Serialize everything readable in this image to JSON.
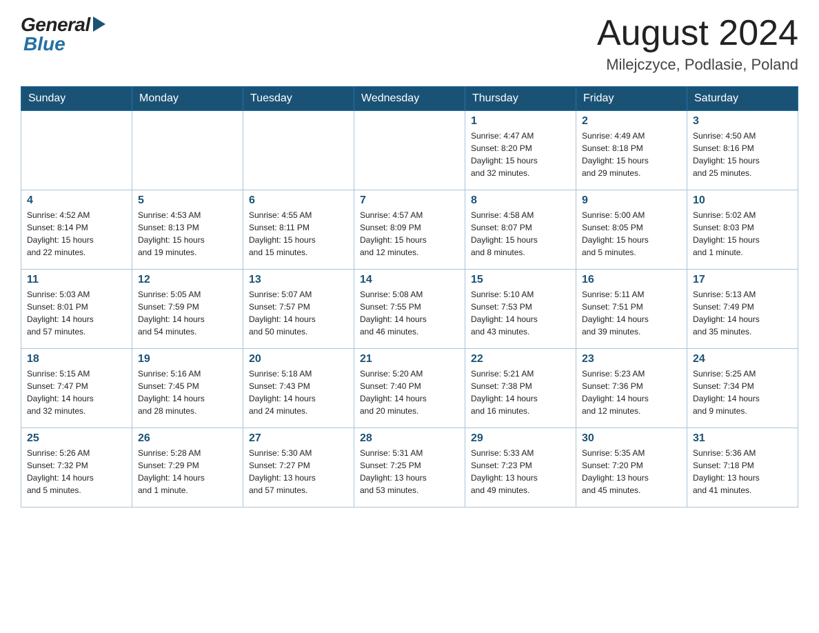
{
  "header": {
    "title": "August 2024",
    "subtitle": "Milejczyce, Podlasie, Poland",
    "logo_general": "General",
    "logo_blue": "Blue"
  },
  "days_of_week": [
    "Sunday",
    "Monday",
    "Tuesday",
    "Wednesday",
    "Thursday",
    "Friday",
    "Saturday"
  ],
  "weeks": [
    {
      "days": [
        {
          "num": "",
          "info": ""
        },
        {
          "num": "",
          "info": ""
        },
        {
          "num": "",
          "info": ""
        },
        {
          "num": "",
          "info": ""
        },
        {
          "num": "1",
          "info": "Sunrise: 4:47 AM\nSunset: 8:20 PM\nDaylight: 15 hours\nand 32 minutes."
        },
        {
          "num": "2",
          "info": "Sunrise: 4:49 AM\nSunset: 8:18 PM\nDaylight: 15 hours\nand 29 minutes."
        },
        {
          "num": "3",
          "info": "Sunrise: 4:50 AM\nSunset: 8:16 PM\nDaylight: 15 hours\nand 25 minutes."
        }
      ]
    },
    {
      "days": [
        {
          "num": "4",
          "info": "Sunrise: 4:52 AM\nSunset: 8:14 PM\nDaylight: 15 hours\nand 22 minutes."
        },
        {
          "num": "5",
          "info": "Sunrise: 4:53 AM\nSunset: 8:13 PM\nDaylight: 15 hours\nand 19 minutes."
        },
        {
          "num": "6",
          "info": "Sunrise: 4:55 AM\nSunset: 8:11 PM\nDaylight: 15 hours\nand 15 minutes."
        },
        {
          "num": "7",
          "info": "Sunrise: 4:57 AM\nSunset: 8:09 PM\nDaylight: 15 hours\nand 12 minutes."
        },
        {
          "num": "8",
          "info": "Sunrise: 4:58 AM\nSunset: 8:07 PM\nDaylight: 15 hours\nand 8 minutes."
        },
        {
          "num": "9",
          "info": "Sunrise: 5:00 AM\nSunset: 8:05 PM\nDaylight: 15 hours\nand 5 minutes."
        },
        {
          "num": "10",
          "info": "Sunrise: 5:02 AM\nSunset: 8:03 PM\nDaylight: 15 hours\nand 1 minute."
        }
      ]
    },
    {
      "days": [
        {
          "num": "11",
          "info": "Sunrise: 5:03 AM\nSunset: 8:01 PM\nDaylight: 14 hours\nand 57 minutes."
        },
        {
          "num": "12",
          "info": "Sunrise: 5:05 AM\nSunset: 7:59 PM\nDaylight: 14 hours\nand 54 minutes."
        },
        {
          "num": "13",
          "info": "Sunrise: 5:07 AM\nSunset: 7:57 PM\nDaylight: 14 hours\nand 50 minutes."
        },
        {
          "num": "14",
          "info": "Sunrise: 5:08 AM\nSunset: 7:55 PM\nDaylight: 14 hours\nand 46 minutes."
        },
        {
          "num": "15",
          "info": "Sunrise: 5:10 AM\nSunset: 7:53 PM\nDaylight: 14 hours\nand 43 minutes."
        },
        {
          "num": "16",
          "info": "Sunrise: 5:11 AM\nSunset: 7:51 PM\nDaylight: 14 hours\nand 39 minutes."
        },
        {
          "num": "17",
          "info": "Sunrise: 5:13 AM\nSunset: 7:49 PM\nDaylight: 14 hours\nand 35 minutes."
        }
      ]
    },
    {
      "days": [
        {
          "num": "18",
          "info": "Sunrise: 5:15 AM\nSunset: 7:47 PM\nDaylight: 14 hours\nand 32 minutes."
        },
        {
          "num": "19",
          "info": "Sunrise: 5:16 AM\nSunset: 7:45 PM\nDaylight: 14 hours\nand 28 minutes."
        },
        {
          "num": "20",
          "info": "Sunrise: 5:18 AM\nSunset: 7:43 PM\nDaylight: 14 hours\nand 24 minutes."
        },
        {
          "num": "21",
          "info": "Sunrise: 5:20 AM\nSunset: 7:40 PM\nDaylight: 14 hours\nand 20 minutes."
        },
        {
          "num": "22",
          "info": "Sunrise: 5:21 AM\nSunset: 7:38 PM\nDaylight: 14 hours\nand 16 minutes."
        },
        {
          "num": "23",
          "info": "Sunrise: 5:23 AM\nSunset: 7:36 PM\nDaylight: 14 hours\nand 12 minutes."
        },
        {
          "num": "24",
          "info": "Sunrise: 5:25 AM\nSunset: 7:34 PM\nDaylight: 14 hours\nand 9 minutes."
        }
      ]
    },
    {
      "days": [
        {
          "num": "25",
          "info": "Sunrise: 5:26 AM\nSunset: 7:32 PM\nDaylight: 14 hours\nand 5 minutes."
        },
        {
          "num": "26",
          "info": "Sunrise: 5:28 AM\nSunset: 7:29 PM\nDaylight: 14 hours\nand 1 minute."
        },
        {
          "num": "27",
          "info": "Sunrise: 5:30 AM\nSunset: 7:27 PM\nDaylight: 13 hours\nand 57 minutes."
        },
        {
          "num": "28",
          "info": "Sunrise: 5:31 AM\nSunset: 7:25 PM\nDaylight: 13 hours\nand 53 minutes."
        },
        {
          "num": "29",
          "info": "Sunrise: 5:33 AM\nSunset: 7:23 PM\nDaylight: 13 hours\nand 49 minutes."
        },
        {
          "num": "30",
          "info": "Sunrise: 5:35 AM\nSunset: 7:20 PM\nDaylight: 13 hours\nand 45 minutes."
        },
        {
          "num": "31",
          "info": "Sunrise: 5:36 AM\nSunset: 7:18 PM\nDaylight: 13 hours\nand 41 minutes."
        }
      ]
    }
  ]
}
